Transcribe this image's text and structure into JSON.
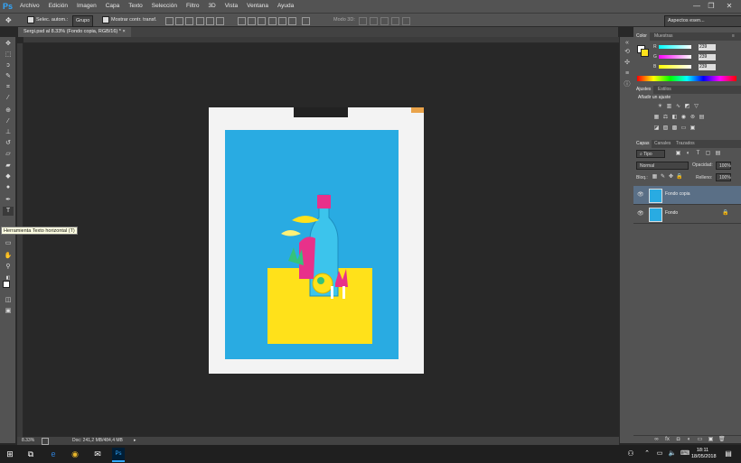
{
  "app": {
    "logo": "Ps",
    "window_controls": [
      "—",
      "❐",
      "✕"
    ]
  },
  "menu": [
    "Archivo",
    "Edición",
    "Imagen",
    "Capa",
    "Texto",
    "Selección",
    "Filtro",
    "3D",
    "Vista",
    "Ventana",
    "Ayuda"
  ],
  "options_bar": {
    "auto_select_label": "Selec. autom.:",
    "auto_select_value": "Grupo",
    "transform_label": "Mostrar contr. transf.",
    "mode3d_label": "Modo 3D:",
    "workspace": "Aspectos esen..."
  },
  "document": {
    "tab_title": "Sergi.psd al 8.33% (Fondo copia, RGB/16) *",
    "zoom": "8.33%",
    "doc_info": "Doc: 241,2 MB/484,4 MB"
  },
  "tooltip": "Herramienta Texto horizontal (T)",
  "color_panel": {
    "tabs": [
      "Color",
      "Muestras"
    ],
    "r_label": "R",
    "r_value": "239",
    "g_label": "G",
    "g_value": "239",
    "b_label": "B",
    "b_value": "239"
  },
  "adjust_panel": {
    "tabs": [
      "Ajustes",
      "Estilos"
    ],
    "heading": "Añadir un ajuste"
  },
  "layers_panel": {
    "tabs": [
      "Capas",
      "Canales",
      "Trazados"
    ],
    "filter": "Tipo",
    "blend_mode": "Normal",
    "opacity_label": "Opacidad:",
    "opacity_value": "100%",
    "lock_label": "Bloq.:",
    "fill_label": "Relleno:",
    "fill_value": "100%",
    "layers": [
      {
        "name": "Fondo copia",
        "selected": true
      },
      {
        "name": "Fondo",
        "selected": false,
        "locked": true
      }
    ]
  },
  "taskbar": {
    "time": "18:11",
    "date": "18/05/2018"
  },
  "colors": {
    "accent": "#31a8ff",
    "paper_blue": "#29abe2",
    "paper_yellow": "#ffe11a",
    "paper_pink": "#e8318a"
  }
}
